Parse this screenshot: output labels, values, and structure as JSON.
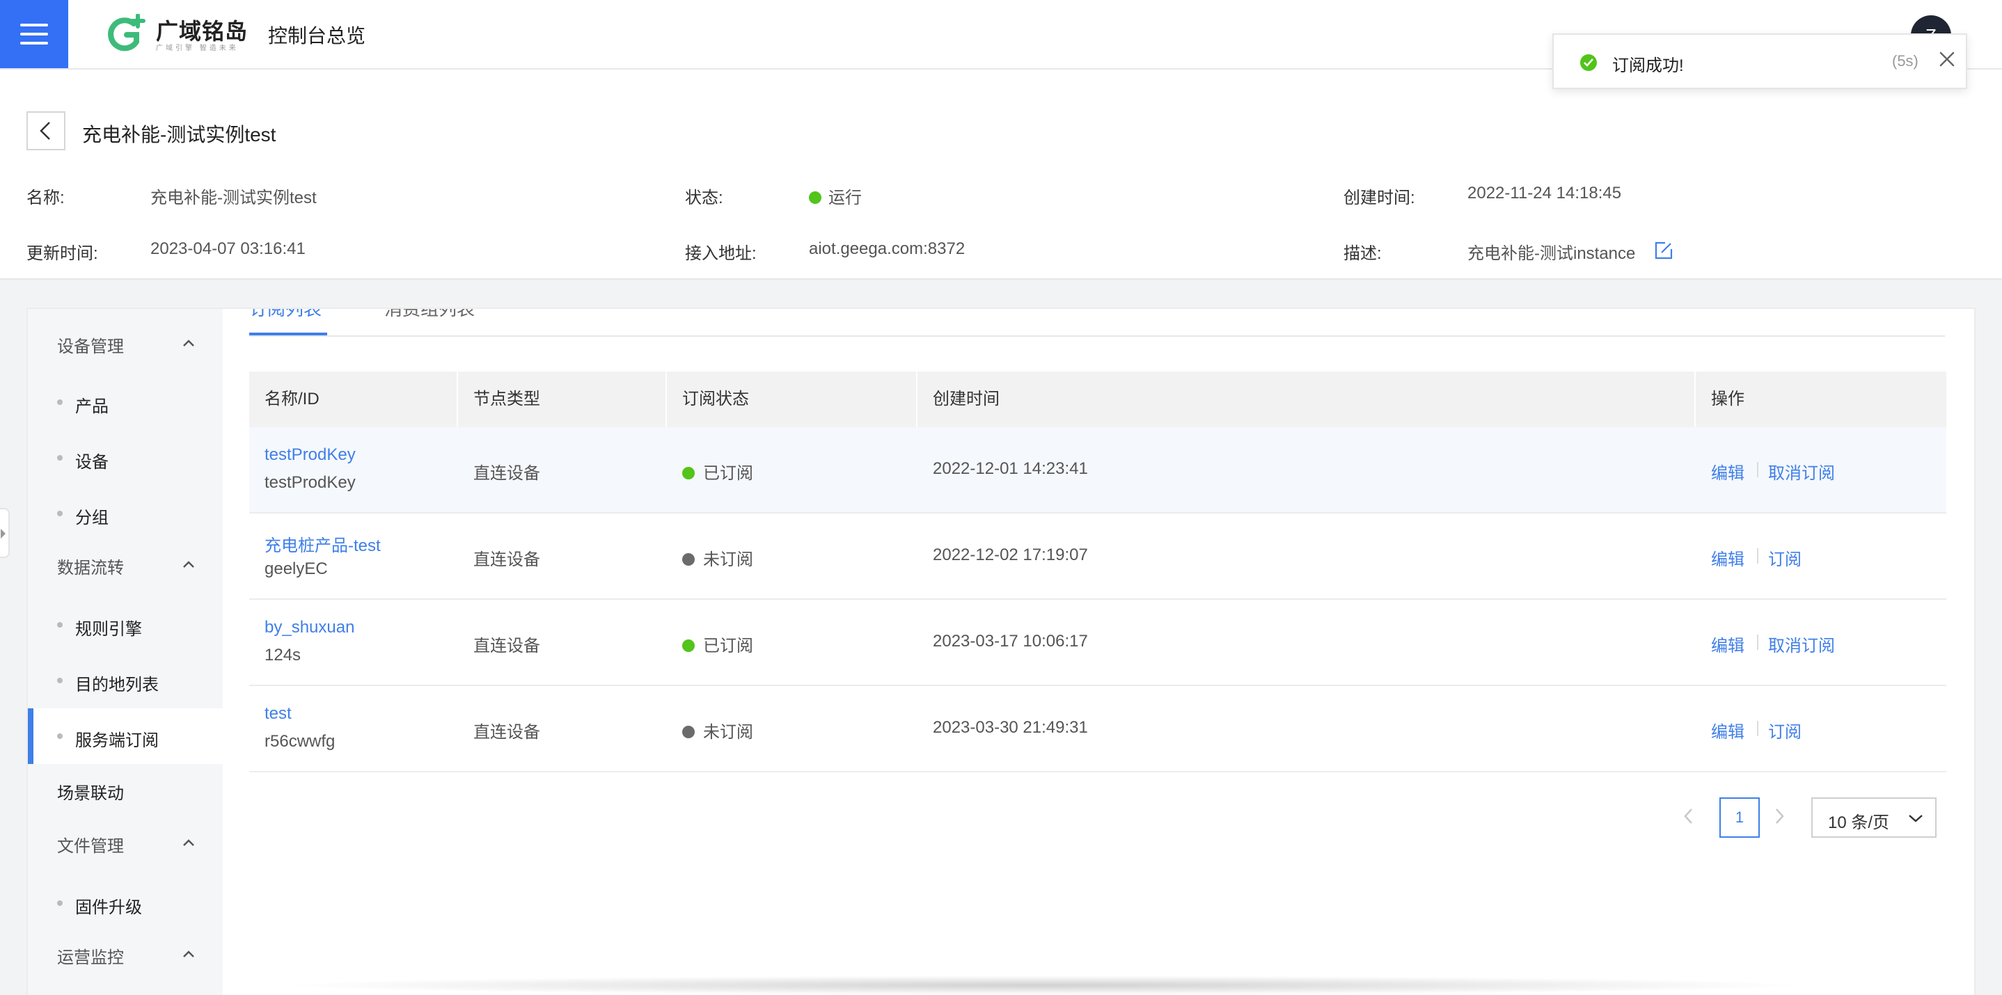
{
  "brand": {
    "name": "广域铭岛",
    "tagline": "广域引擎 智造未来",
    "color": "#3370f5"
  },
  "header": {
    "console_title": "控制台总览",
    "avatar_initial": "Z"
  },
  "toast": {
    "message": "订阅成功!",
    "countdown": "(5s)",
    "type": "success"
  },
  "instance": {
    "title": "充电补能-测试实例test",
    "fields": {
      "name_label": "名称:",
      "name_value": "充电补能-测试实例test",
      "status_label": "状态:",
      "status_value": "运行",
      "created_label": "创建时间:",
      "created_value": "2022-11-24 14:18:45",
      "updated_label": "更新时间:",
      "updated_value": "2023-04-07 03:16:41",
      "endpoint_label": "接入地址:",
      "endpoint_value": "aiot.geega.com:8372",
      "desc_label": "描述:",
      "desc_value": "充电补能-测试instance"
    }
  },
  "sidebar": {
    "groups": [
      {
        "label": "设备管理",
        "items": [
          "产品",
          "设备",
          "分组"
        ]
      },
      {
        "label": "数据流转",
        "items": [
          "规则引擎",
          "目的地列表",
          "服务端订阅"
        ]
      },
      {
        "label": "场景联动"
      },
      {
        "label": "文件管理",
        "items": [
          "固件升级"
        ]
      },
      {
        "label": "运营监控"
      }
    ],
    "active_item": "服务端订阅"
  },
  "tabs": [
    {
      "label": "订阅列表",
      "active": true
    },
    {
      "label": "消费组列表",
      "active": false
    }
  ],
  "table": {
    "columns": [
      "名称/ID",
      "节点类型",
      "订阅状态",
      "创建时间",
      "操作"
    ],
    "rows": [
      {
        "name": "testProdKey",
        "id": "testProdKey",
        "node_type": "直连设备",
        "status": "已订阅",
        "created": "2022-12-01 14:23:41",
        "op_edit": "编辑",
        "op_action": "取消订阅"
      },
      {
        "name": "充电桩产品-test",
        "id": "geelyEC",
        "node_type": "直连设备",
        "status": "未订阅",
        "created": "2022-12-02 17:19:07",
        "op_edit": "编辑",
        "op_action": "订阅"
      },
      {
        "name": "by_shuxuan",
        "id": "124s",
        "node_type": "直连设备",
        "status": "已订阅",
        "created": "2023-03-17 10:06:17",
        "op_edit": "编辑",
        "op_action": "取消订阅"
      },
      {
        "name": "test",
        "id": "r56cwwfg",
        "node_type": "直连设备",
        "status": "未订阅",
        "created": "2023-03-30 21:49:31",
        "op_edit": "编辑",
        "op_action": "订阅"
      }
    ]
  },
  "pagination": {
    "current_page": "1",
    "page_size": "10 条/页"
  },
  "colors": {
    "accent": "#3f7fe8",
    "success": "#52c41a",
    "inactive": "#6b6b6b"
  }
}
